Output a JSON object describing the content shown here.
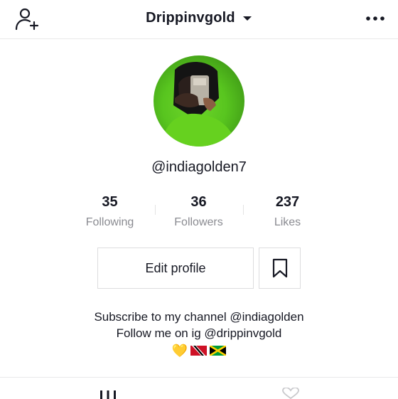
{
  "header": {
    "title": "Drippinvgold",
    "add_user_icon": "person-add-icon",
    "dropdown_icon": "caret-down-icon",
    "more_icon": "more-horizontal-icon"
  },
  "profile": {
    "avatar": "avatar",
    "username": "@indiagolden7"
  },
  "stats": [
    {
      "value": "35",
      "label": "Following"
    },
    {
      "value": "36",
      "label": "Followers"
    },
    {
      "value": "237",
      "label": "Likes"
    }
  ],
  "actions": {
    "edit_label": "Edit profile",
    "bookmark_icon": "bookmark-icon"
  },
  "bio": {
    "line1": "Subscribe to my channel @indiagolden",
    "line2": "Follow me on ig @drippinvgold",
    "emojis": [
      "yellow-heart",
      "flag-trinidad-tobago",
      "flag-jamaica"
    ],
    "emoji_heart": "💛"
  },
  "tabs": {
    "videos_icon": "grid-icon",
    "liked_icon": "heart-icon"
  },
  "colors": {
    "text": "#161823",
    "muted": "#8a8b91",
    "border": "#dcdcde"
  }
}
